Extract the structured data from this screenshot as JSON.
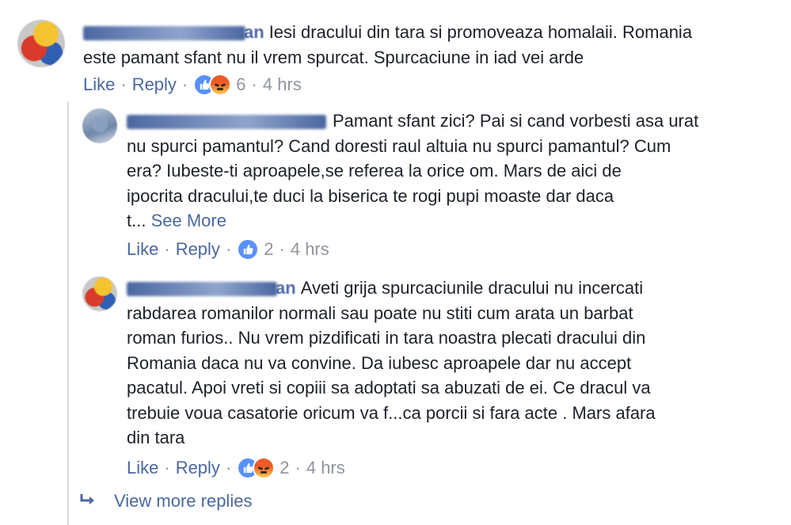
{
  "comments": [
    {
      "author_suffix": "an",
      "text_lines": [
        "Iesi dracului din tara si promoveaza homalaii. Romania",
        "este pamant sfant nu il vrem spurcat. Spurcaciune in iad vei arde"
      ],
      "actions": {
        "like": "Like",
        "reply": "Reply",
        "reaction_count": "6",
        "time": "4 hrs"
      },
      "reactions": [
        "like-icon",
        "angry-icon"
      ]
    },
    {
      "author_suffix": "",
      "text_lines": [
        "Pamant sfant zici? Pai si cand vorbesti asa urat",
        "nu spurci pamantul? Cand doresti raul altuia nu spurci pamantul? Cum",
        "era? Iubeste-ti aproapele,se referea la orice om. Mars de aici de",
        "ipocrita dracului,te duci la biserica te rogi pupi moaste dar daca",
        "t..."
      ],
      "see_more": "See More",
      "actions": {
        "like": "Like",
        "reply": "Reply",
        "reaction_count": "2",
        "time": "4 hrs"
      },
      "reactions": [
        "like-icon"
      ]
    },
    {
      "author_suffix": "an",
      "text_lines": [
        "Aveti grija spurcaciunile dracului nu incercati",
        "rabdarea romanilor normali sau poate nu stiti cum arata un barbat",
        "roman furios.. Nu vrem pizdificati in tara noastra plecati dracului din",
        "Romania daca nu va convine. Da iubesc aproapele dar nu accept",
        "pacatul. Apoi vreti si copiii sa adoptati sa abuzati de ei. Ce dracul va",
        "trebuie voua casatorie oricum va f...ca porcii si fara acte . Mars afara",
        "din tara"
      ],
      "actions": {
        "like": "Like",
        "reply": "Reply",
        "reaction_count": "2",
        "time": "4 hrs"
      },
      "reactions": [
        "like-icon",
        "angry-icon"
      ]
    }
  ],
  "more_replies": {
    "label": "View more replies",
    "icon": "reply-arrow-icon"
  },
  "colors": {
    "link": "#4b67a1",
    "meta": "#90949c",
    "text": "#1d2129",
    "like": "#5890ff"
  }
}
